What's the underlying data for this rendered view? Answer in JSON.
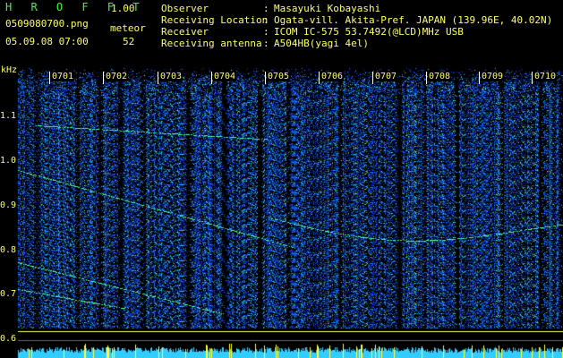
{
  "header": {
    "app_title": "H R O F F T",
    "app_version": "1.00",
    "file_name": "0509080700.png",
    "datetime": "05.09.08 07:00",
    "meteor_label": "meteor",
    "meteor_count": "52"
  },
  "info": [
    {
      "label": "Observer",
      "colon": ":",
      "value": "Masayuki Kobayashi"
    },
    {
      "label": "Receiving Location",
      "colon": ":",
      "value": "Ogata-vill. Akita-Pref. JAPAN (139.96E, 40.02N)"
    },
    {
      "label": "Receiver",
      "colon": ":",
      "value": "ICOM IC-575 53.7492(@LCD)MHz USB"
    },
    {
      "label": "Receiving antenna",
      "colon": ":",
      "value": "A504HB(yagi 4el)"
    }
  ],
  "spectrogram": {
    "y_unit": "kHz",
    "y_ticks": [
      "1.1",
      "1.0",
      "0.9",
      "0.8",
      "0.7",
      "0.6"
    ],
    "x_ticks": [
      "0701",
      "0702",
      "0703",
      "0704",
      "0705",
      "0706",
      "0707",
      "0708",
      "0709",
      "0710"
    ],
    "colors": {
      "background": "#000000",
      "noise_low": "#0a1a8c",
      "noise_high": "#1e5aff",
      "signal": "#33ff99",
      "bright": "#ffff33",
      "baseline": "#33ccff"
    }
  }
}
